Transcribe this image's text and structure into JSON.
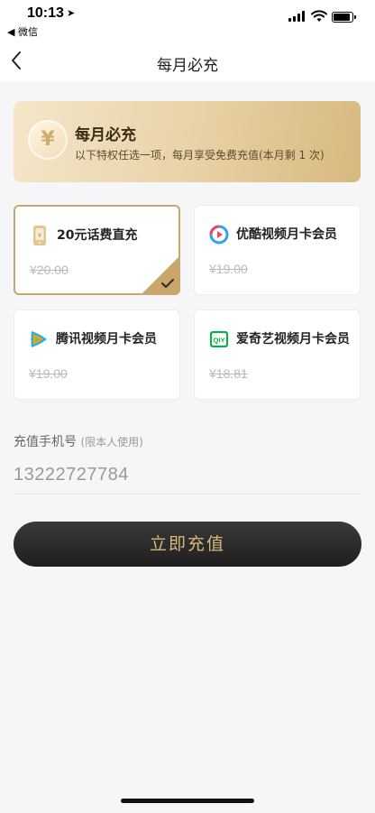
{
  "status_bar": {
    "time": "10:13",
    "back_app": "◀ 微信"
  },
  "nav": {
    "title": "每月必充"
  },
  "banner": {
    "coin_symbol": "¥",
    "title": "每月必充",
    "subtitle": "以下特权任选一项，每月享受免费充值(本月剩 1 次)"
  },
  "cards": [
    {
      "name": "20元话费直充",
      "price": "¥20.00",
      "icon": "phone-icon",
      "selected": true
    },
    {
      "name": "优酷视频月卡会员",
      "price": "¥19.00",
      "icon": "youku-icon",
      "selected": false
    },
    {
      "name": "腾讯视频月卡会员",
      "price": "¥19.00",
      "icon": "tencent-video-icon",
      "selected": false
    },
    {
      "name": "爱奇艺视频月卡会员",
      "price": "¥18.81",
      "icon": "iqiyi-icon",
      "selected": false
    }
  ],
  "phone": {
    "label": "充值手机号",
    "hint": "(限本人使用)",
    "value": "13222727784"
  },
  "button": {
    "label": "立即充值"
  },
  "colors": {
    "gold": "#c9a66b",
    "button_text": "#d9b77a",
    "button_bg": "#262626"
  }
}
